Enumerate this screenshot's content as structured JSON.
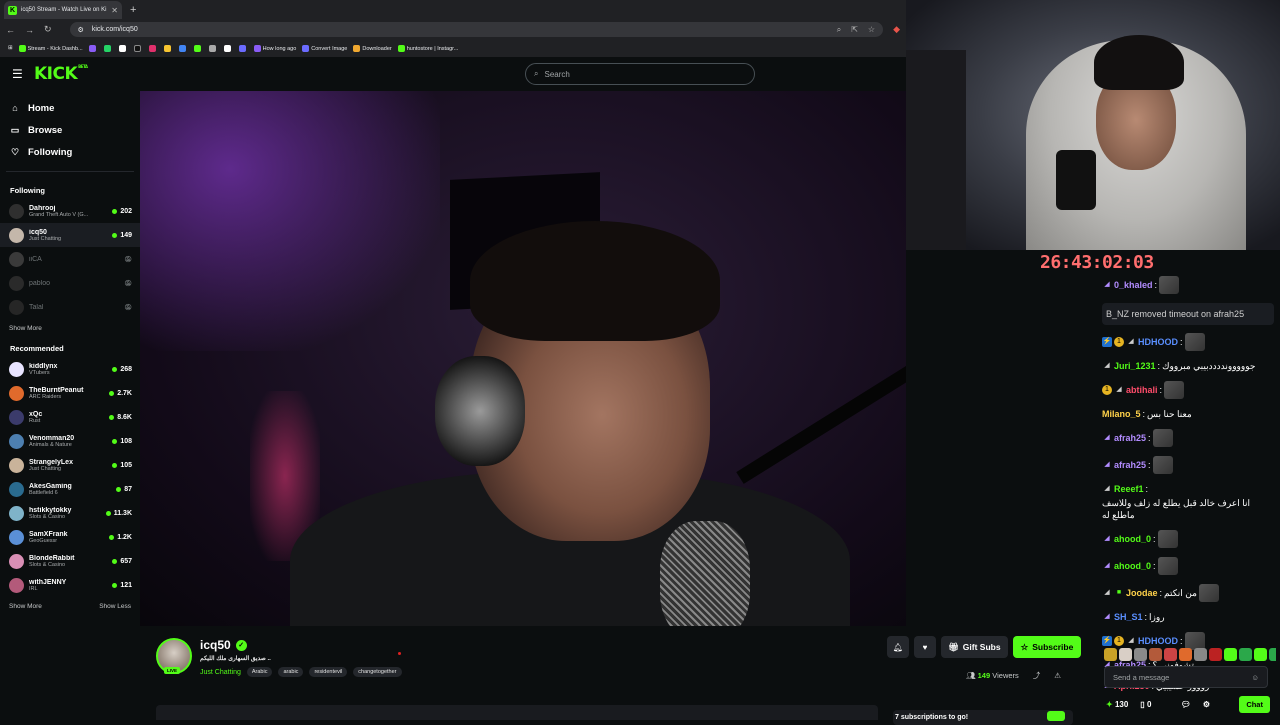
{
  "browser": {
    "tab_title": "icq50 Stream - Watch Live on Ki",
    "url": "kick.com/icq50",
    "bookmarks": [
      "Stream - Kick Dashb...",
      "How long ago",
      "Convert Image",
      "Downloader",
      "huntostore | Instagr..."
    ]
  },
  "header": {
    "logo": "KICK",
    "logo_sup": "BETA",
    "search_placeholder": "Search"
  },
  "sidebar": {
    "nav": [
      {
        "label": "Home",
        "icon": "home-icon"
      },
      {
        "label": "Browse",
        "icon": "browse-icon"
      },
      {
        "label": "Following",
        "icon": "heart-icon"
      }
    ],
    "following_title": "Following",
    "following": [
      {
        "name": "Dahrooj",
        "category": "Grand Theft Auto V (G...",
        "viewers": "202",
        "live": true,
        "color": "#2f2f2f"
      },
      {
        "name": "icq50",
        "category": "Just Chatting",
        "viewers": "149",
        "live": true,
        "color": "#c4b7aa"
      },
      {
        "name": "iiCA",
        "category": "",
        "viewers": "",
        "live": false,
        "color": "#3a3a3a"
      },
      {
        "name": "pabloo",
        "category": "",
        "viewers": "",
        "live": false,
        "color": "#2a2a2a"
      },
      {
        "name": "Talal",
        "category": "",
        "viewers": "",
        "live": false,
        "color": "#262626"
      }
    ],
    "show_more_following": "Show More",
    "recommended_title": "Recommended",
    "recommended": [
      {
        "name": "kiddlynx",
        "category": "VTubers",
        "viewers": "268",
        "color": "#e8e4ff"
      },
      {
        "name": "TheBurntPeanut",
        "category": "ARC Raiders",
        "viewers": "2.7K",
        "color": "#e06a2c"
      },
      {
        "name": "xQc",
        "category": "Rust",
        "viewers": "8.6K",
        "color": "#3b3b6b"
      },
      {
        "name": "Venomman20",
        "category": "Animals & Nature",
        "viewers": "108",
        "color": "#4d7fb0"
      },
      {
        "name": "StrangelyLex",
        "category": "Just Chatting",
        "viewers": "105",
        "color": "#c9b39a"
      },
      {
        "name": "AkesGaming",
        "category": "Battlefield 6",
        "viewers": "87",
        "color": "#2a6b8f"
      },
      {
        "name": "hstikkytokky",
        "category": "Slots & Casino",
        "viewers": "11.3K",
        "color": "#7fb3c9"
      },
      {
        "name": "SamXFrank",
        "category": "GeoGuessr",
        "viewers": "1.2K",
        "color": "#5a8fd6"
      },
      {
        "name": "BlondeRabbit",
        "category": "Slots & Casino",
        "viewers": "657",
        "color": "#d98fb5"
      },
      {
        "name": "withJENNY",
        "category": "IRL",
        "viewers": "121",
        "color": "#b35a7a"
      }
    ],
    "show_more": "Show More",
    "show_less": "Show Less"
  },
  "stream": {
    "name": "icq50",
    "title": "صديق السهارى ملك الليكم ..",
    "category": "Just Chatting",
    "tags": [
      "Arabic",
      "arabic",
      "residentevil",
      "changetogether"
    ],
    "live_badge": "LIVE",
    "gift_label": "Gift Subs",
    "subscribe_label": "Subscribe",
    "viewers_count": "149",
    "viewers_label": "Viewers",
    "subs_box_label": "7 subscriptions to go!"
  },
  "overlay": {
    "timer": "26:43:02:03"
  },
  "chat": {
    "messages": [
      {
        "user": "0_khaled",
        "color": "#b28cff",
        "text": "",
        "badges": [
          "purple"
        ],
        "emote": true
      },
      {
        "system": true,
        "text": "B_NZ removed timeout on afrah25"
      },
      {
        "user": "HDHOOD",
        "color": "#5a8fff",
        "text": "",
        "badges": [
          "blue",
          "gold",
          "gray"
        ],
        "emote": true
      },
      {
        "user": "Juri_1231",
        "color": "#53fc18",
        "text": "جووووونددددبيبي مبرووك",
        "badges": [
          "gray"
        ],
        "emote": false
      },
      {
        "user": "abtihali",
        "color": "#ff4d6b",
        "text": "",
        "badges": [
          "gold",
          "gray"
        ],
        "emote": true
      },
      {
        "user": "Milano_5",
        "color": "#ffd24a",
        "text": "معنا حنا بس",
        "badges": [],
        "emote": false
      },
      {
        "user": "afrah25",
        "color": "#b28cff",
        "text": "",
        "badges": [
          "purple"
        ],
        "emote": true
      },
      {
        "user": "afrah25",
        "color": "#b28cff",
        "text": "",
        "badges": [
          "purple"
        ],
        "emote": true
      },
      {
        "user": "Reeef1",
        "color": "#53fc18",
        "text": "انا اعرف خالد قبل يطلع له زلف وللاسف ماطلع له",
        "badges": [
          "gray"
        ],
        "emote": false
      },
      {
        "user": "ahood_0",
        "color": "#53fc18",
        "text": "",
        "badges": [
          "purple"
        ],
        "emote": true
      },
      {
        "user": "ahood_0",
        "color": "#53fc18",
        "text": "",
        "badges": [
          "purple"
        ],
        "emote": true
      },
      {
        "user": "Joodae",
        "color": "#ffd24a",
        "text": "من انكتم",
        "badges": [
          "gray",
          "green"
        ],
        "emote": true
      },
      {
        "user": "SH_S1",
        "color": "#5a8fff",
        "text": "روزا",
        "badges": [
          "purple"
        ],
        "emote": false
      },
      {
        "user": "HDHOOD",
        "color": "#5a8fff",
        "text": "",
        "badges": [
          "blue",
          "gold",
          "gray"
        ],
        "emote": true
      },
      {
        "user": "afrah25",
        "color": "#b28cff",
        "text": "تشوفوني ؟",
        "badges": [
          "purple"
        ],
        "emote": false
      },
      {
        "user": "April230",
        "color": "#ff4d6b",
        "text": "روووز عشيبيي",
        "badges": [
          "purple"
        ],
        "emote": false
      }
    ],
    "input_placeholder": "Send a message",
    "points": "130",
    "count": "0",
    "chat_button": "Chat"
  },
  "colors": {
    "brand": "#53fc18",
    "background": "#0b0e0f"
  }
}
